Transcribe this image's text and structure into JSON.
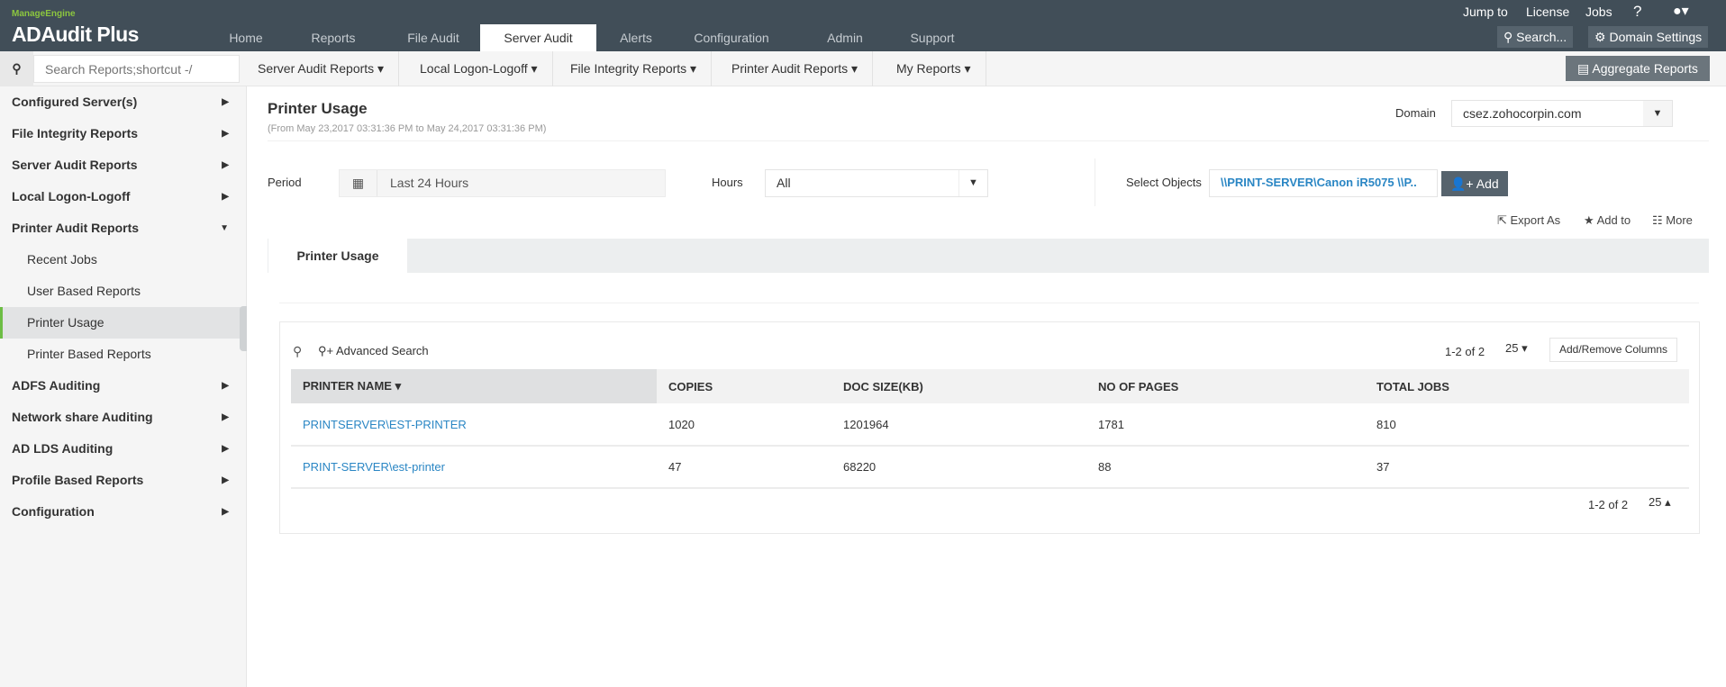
{
  "brand": {
    "vendor": "ManageEngine",
    "product": "ADAudit Plus"
  },
  "tabs": [
    {
      "label": "Home"
    },
    {
      "label": "Reports"
    },
    {
      "label": "File Audit"
    },
    {
      "label": "Server Audit",
      "active": true
    },
    {
      "label": "Alerts"
    },
    {
      "label": "Configuration"
    },
    {
      "label": "Admin"
    },
    {
      "label": "Support"
    }
  ],
  "toplinks": {
    "jump": "Jump to",
    "license": "License",
    "jobs": "Jobs",
    "help": "?"
  },
  "topbuttons": {
    "search": "Search...",
    "domain_settings": "Domain Settings"
  },
  "subnav": {
    "search_placeholder": "Search Reports;shortcut -/",
    "items": [
      "Server Audit Reports",
      "Local Logon-Logoff",
      "File Integrity Reports",
      "Printer Audit Reports",
      "My Reports"
    ],
    "aggregate": "Aggregate Reports"
  },
  "sidebar": [
    {
      "label": "Configured Server(s)",
      "type": "group"
    },
    {
      "label": "File Integrity Reports",
      "type": "group"
    },
    {
      "label": "Server Audit Reports",
      "type": "group"
    },
    {
      "label": "Local Logon-Logoff",
      "type": "group"
    },
    {
      "label": "Printer Audit Reports",
      "type": "group",
      "expanded": true
    },
    {
      "label": "Recent Jobs",
      "type": "sub"
    },
    {
      "label": "User Based Reports",
      "type": "sub"
    },
    {
      "label": "Printer Usage",
      "type": "sub",
      "selected": true
    },
    {
      "label": "Printer Based Reports",
      "type": "sub"
    },
    {
      "label": "ADFS Auditing",
      "type": "group"
    },
    {
      "label": "Network share Auditing",
      "type": "group"
    },
    {
      "label": "AD LDS Auditing",
      "type": "group"
    },
    {
      "label": "Profile Based Reports",
      "type": "group"
    },
    {
      "label": "Configuration",
      "type": "group"
    }
  ],
  "report": {
    "title": "Printer Usage",
    "range": "(From May 23,2017 03:31:36 PM to May 24,2017 03:31:36 PM)",
    "domain_label": "Domain",
    "domain_value": "csez.zohocorpin.com",
    "period_label": "Period",
    "period_value": "Last 24 Hours",
    "hours_label": "Hours",
    "hours_value": "All",
    "objects_label": "Select Objects",
    "objects_value": "\\\\PRINT-SERVER\\Canon iR5075 \\\\P..",
    "add": "Add",
    "export": "Export As",
    "addto": "Add to",
    "more": "More",
    "tab": "Printer Usage",
    "advanced_search": "Advanced Search",
    "pagination": "1-2 of 2",
    "per_page": "25",
    "add_remove_columns": "Add/Remove Columns"
  },
  "table": {
    "columns": [
      "PRINTER NAME",
      "COPIES",
      "DOC SIZE(KB)",
      "NO OF PAGES",
      "TOTAL JOBS"
    ],
    "rows": [
      [
        "PRINTSERVER\\EST-PRINTER",
        "1020",
        "1201964",
        "1781",
        "810"
      ],
      [
        "PRINT-SERVER\\est-printer",
        "47",
        "68220",
        "88",
        "37"
      ]
    ]
  },
  "colors": {
    "topbar": "#414e58",
    "accent": "#6dbd45",
    "link": "#2a86c4"
  }
}
